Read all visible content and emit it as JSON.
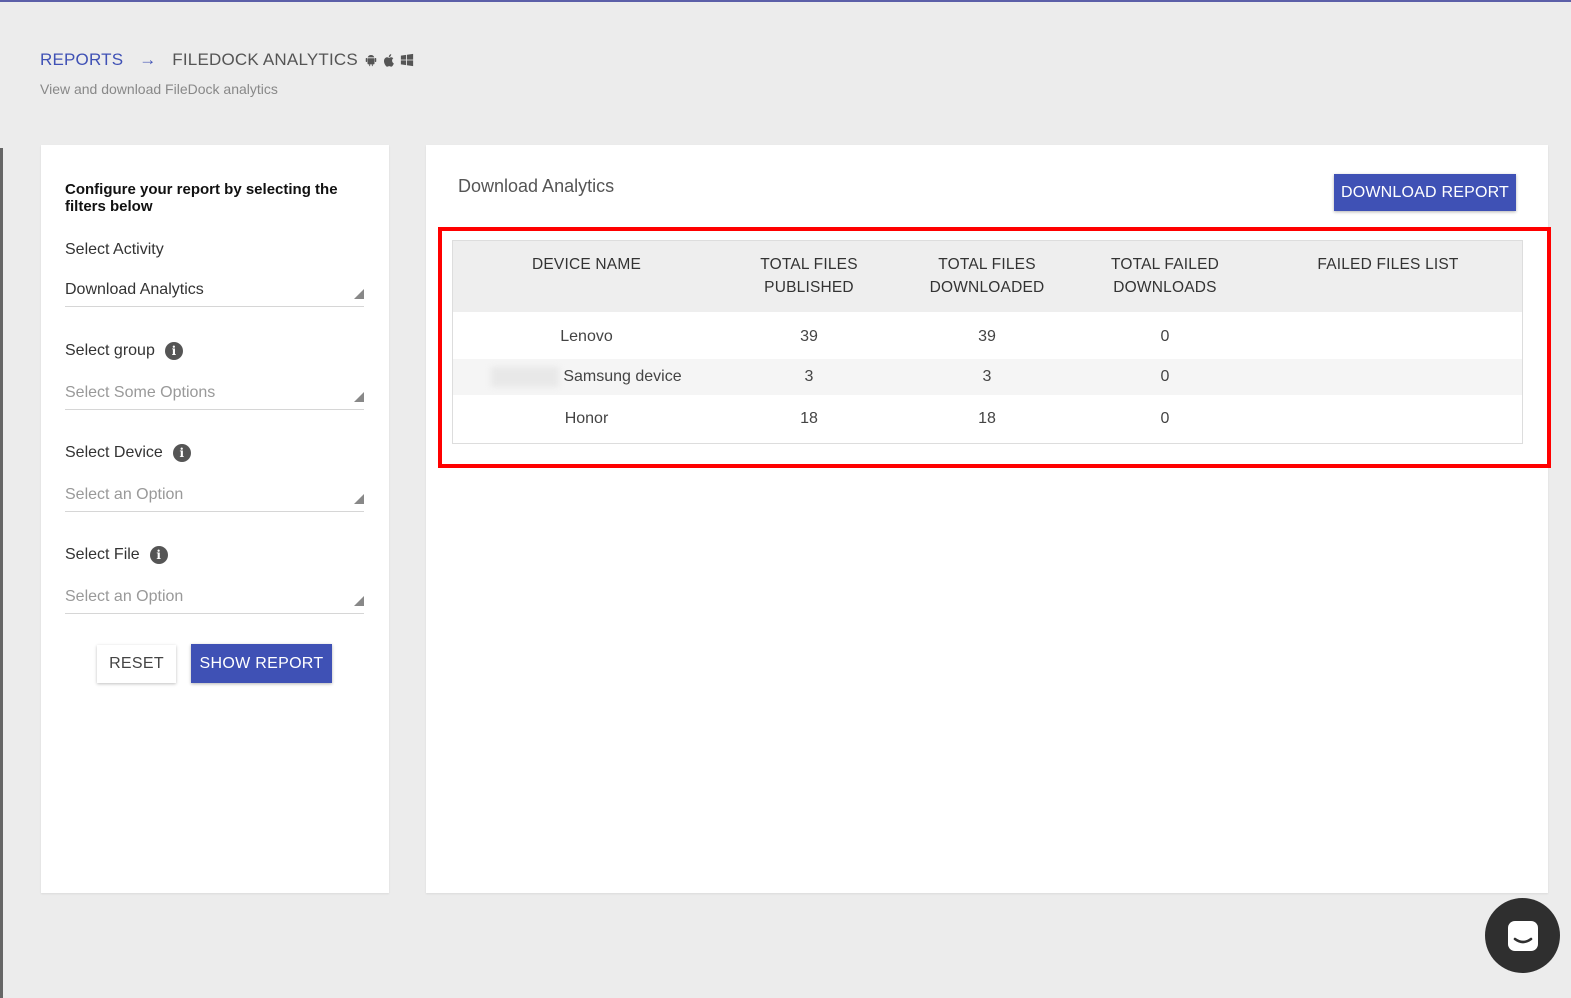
{
  "breadcrumb": {
    "root": "REPORTS",
    "arrow": "→",
    "current": "FILEDOCK ANALYTICS",
    "platform_icons": [
      "android-icon",
      "apple-icon",
      "windows-icon"
    ]
  },
  "subtitle": "View and download FileDock analytics",
  "filters": {
    "heading": "Configure your report by selecting the filters below",
    "activity": {
      "label": "Select Activity",
      "value": "Download Analytics"
    },
    "group": {
      "label": "Select group",
      "placeholder": "Select Some Options"
    },
    "device": {
      "label": "Select Device",
      "placeholder": "Select an Option"
    },
    "file": {
      "label": "Select File",
      "placeholder": "Select an Option"
    },
    "reset_label": "RESET",
    "show_label": "SHOW REPORT"
  },
  "main": {
    "title": "Download Analytics",
    "download_label": "DOWNLOAD REPORT",
    "table": {
      "headers": [
        {
          "line1": "DEVICE NAME",
          "line2": ""
        },
        {
          "line1": "TOTAL FILES",
          "line2": "PUBLISHED"
        },
        {
          "line1": "TOTAL FILES",
          "line2": "DOWNLOADED"
        },
        {
          "line1": "TOTAL FAILED",
          "line2": "DOWNLOADS"
        },
        {
          "line1": "FAILED FILES LIST",
          "line2": ""
        }
      ],
      "rows": [
        {
          "device": "Lenovo",
          "published": "39",
          "downloaded": "39",
          "failed": "0",
          "failed_list": ""
        },
        {
          "device": "Samsung device",
          "published": "3",
          "downloaded": "3",
          "failed": "0",
          "failed_list": ""
        },
        {
          "device": "Honor",
          "published": "18",
          "downloaded": "18",
          "failed": "0",
          "failed_list": ""
        }
      ]
    }
  },
  "colors": {
    "accent": "#3f51b5",
    "highlight": "#ff0000",
    "chat": "#2f2f2f"
  }
}
